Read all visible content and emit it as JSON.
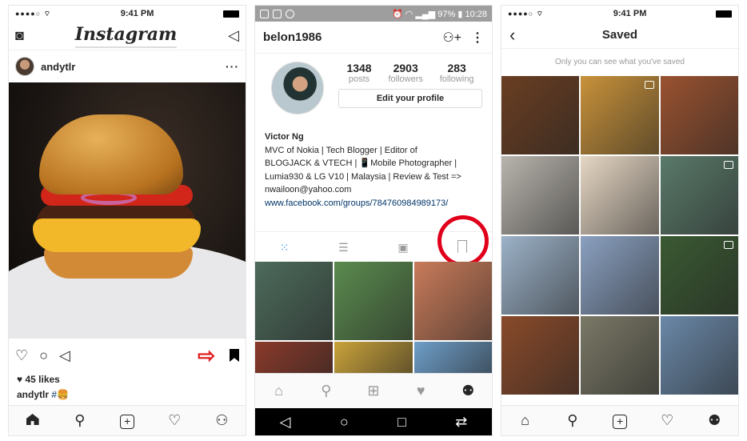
{
  "panel1": {
    "status": {
      "time": "9:41 PM"
    },
    "header": {
      "logo": "Instagram"
    },
    "post": {
      "username": "andytlr",
      "likes": "45 likes",
      "caption_user": "andytlr",
      "caption_text": "#🍔"
    }
  },
  "panel2": {
    "status": {
      "battery": "97%",
      "time": "10:28"
    },
    "username": "belon1986",
    "stats": [
      {
        "value": "1348",
        "label": "posts"
      },
      {
        "value": "2903",
        "label": "followers"
      },
      {
        "value": "283",
        "label": "following"
      }
    ],
    "edit_label": "Edit your profile",
    "bio": {
      "name": "Victor Ng",
      "lines": [
        "MVC of Nokia | Tech Blogger | Editor of",
        "BLOGJACK & VTECH | 📱Mobile Photographer |",
        "Lumia930 & LG V10 | Malaysia | Review & Test =>",
        "nwailoon@yahoo.com"
      ],
      "link": "www.facebook.com/groups/784760984989173/"
    },
    "grid_colors": [
      "#4d6b5c",
      "#5a8a4e",
      "#c97b5a",
      "#8a3a2a",
      "#c9a23a",
      "#6e9ec8"
    ]
  },
  "panel3": {
    "status": {
      "time": "9:41 PM"
    },
    "title": "Saved",
    "note": "Only you can see what you've saved",
    "grid_colors": [
      "#6a3e22",
      "#c8923a",
      "#9a5230",
      "#b8b4ad",
      "#e6d7c4",
      "#5a7a6a",
      "#9cb2c8",
      "#8aa0c0",
      "#3a5a32",
      "#8a4a2a",
      "#7a7866",
      "#6a88a8"
    ]
  },
  "colors": {
    "accent": "#3897f0",
    "annotation_red": "#e0001b",
    "link": "#003569"
  }
}
